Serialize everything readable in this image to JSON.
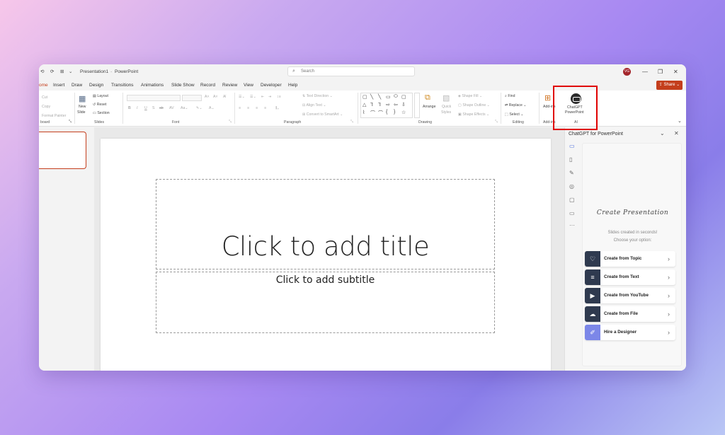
{
  "titlebar": {
    "doc_title": "Presentation1",
    "app_name": "PowerPoint",
    "search_placeholder": "Search",
    "avatar_initials": "VG"
  },
  "menu": {
    "tabs": [
      "ome",
      "Insert",
      "Draw",
      "Design",
      "Transitions",
      "Animations",
      "Slide Show",
      "Record",
      "Review",
      "View",
      "Developer",
      "Help"
    ],
    "share_label": "Share"
  },
  "ribbon": {
    "clipboard": {
      "cut": "Cut",
      "copy": "Copy",
      "format_painter": "Format Painter",
      "label": "board"
    },
    "slides": {
      "new_slide": "New",
      "new_slide2": "Slide",
      "layout": "Layout",
      "reset": "Reset",
      "section": "Section",
      "label": "Slides"
    },
    "font": {
      "label": "Font"
    },
    "paragraph": {
      "text_direction": "Text Direction",
      "align_text": "Align Text",
      "convert_smartart": "Convert to SmartArt",
      "label": "Paragraph"
    },
    "drawing": {
      "arrange": "Arrange",
      "quick_styles": "Quick",
      "quick_styles2": "Styles",
      "shape_fill": "Shape Fill",
      "shape_outline": "Shape Outline",
      "shape_effects": "Shape Effects",
      "label": "Drawing"
    },
    "editing": {
      "find": "Find",
      "replace": "Replace",
      "select": "Select",
      "label": "Editing"
    },
    "addins": {
      "addins": "Add-ins",
      "label": "Add-ins"
    },
    "ai": {
      "chatgpt": "ChatGPT",
      "chatgpt2": "PowerPoint",
      "label": "AI"
    }
  },
  "slide": {
    "title_placeholder": "Click to add title",
    "subtitle_placeholder": "Click to add subtitle"
  },
  "side_panel": {
    "title": "ChatGPT for PowerPoint",
    "heading": "Create Presentation",
    "desc1": "Slides created in seconds!",
    "desc2": "Choose your option:",
    "options": [
      {
        "label": "Create from Topic",
        "icon": "lightbulb-icon"
      },
      {
        "label": "Create from Text",
        "icon": "text-lines-icon"
      },
      {
        "label": "Create from YouTube",
        "icon": "youtube-icon"
      },
      {
        "label": "Create from File",
        "icon": "cloud-upload-icon"
      },
      {
        "label": "Hire a Designer",
        "icon": "designer-icon"
      }
    ]
  },
  "colors": {
    "accent": "#c43e1c",
    "highlight": "#e00000",
    "option_icon_bg": "#2f3a4f",
    "designer_icon_bg": "#7c87e8"
  }
}
